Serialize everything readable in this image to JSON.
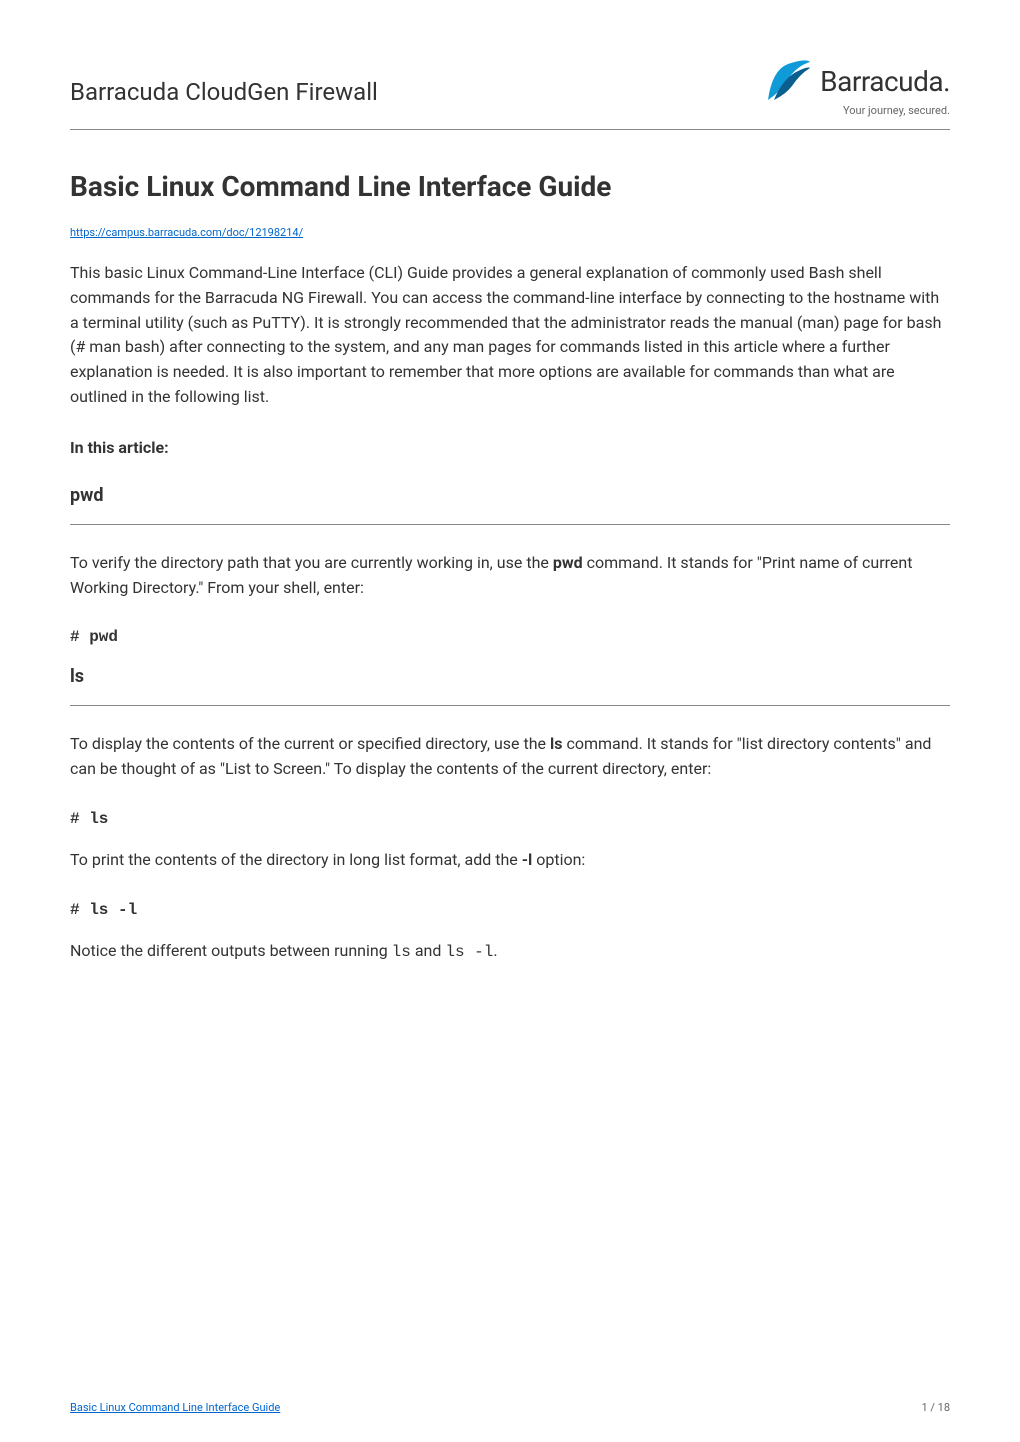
{
  "header": {
    "product_name": "Barracuda CloudGen Firewall",
    "logo_text": "Barracuda.",
    "tagline": "Your journey, secured."
  },
  "page": {
    "title": "Basic Linux Command Line Interface Guide",
    "doc_url": "https://campus.barracuda.com/doc/12198214/",
    "intro_text": "This basic Linux Command-Line Interface (CLI) Guide provides a general explanation of commonly used Bash shell commands for the Barracuda NG Firewall. You can access the command-line interface by connecting to the hostname with a terminal utility (such as PuTTY). It is strongly recommended that the administrator reads the manual (man) page for bash (# man bash) after connecting to the system, and any man pages for commands listed in this article where a further explanation is needed. It is also important to remember that more options are available for commands than what are outlined in the following list.",
    "in_this_article": "In this article:"
  },
  "sections": {
    "pwd": {
      "heading": "pwd",
      "desc_pre": "To verify the directory path that you are currently working in, use the ",
      "desc_bold": "pwd",
      "desc_post": " command. It stands for \"Print name of current Working Directory.\" From your shell, enter:",
      "cmd": "# pwd"
    },
    "ls": {
      "heading": "ls",
      "desc1_pre": "To display the contents of the current or specified directory, use the ",
      "desc1_bold": "ls",
      "desc1_post": " command. It stands for \"list directory contents\" and can be thought of as \"List to Screen.\" To display the contents of the current directory, enter:",
      "cmd1": "# ls",
      "desc2_pre": "To print the contents of the directory in long list format, add the ",
      "desc2_bold": "-l",
      "desc2_post": " option:",
      "cmd2": "# ls -l",
      "desc3_pre": "Notice the different outputs between running ",
      "desc3_code1": "ls",
      "desc3_mid": " and ",
      "desc3_code2": "ls -l",
      "desc3_post": "."
    }
  },
  "footer": {
    "link_text": "Basic Linux Command Line Interface Guide",
    "page_indicator": "1 / 18"
  }
}
